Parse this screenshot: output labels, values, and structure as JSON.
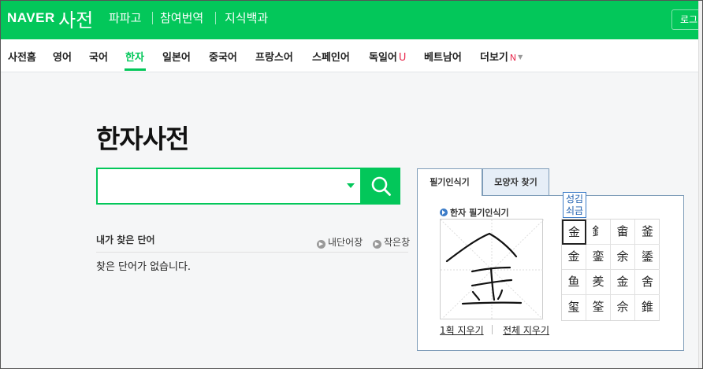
{
  "header": {
    "logo": "NAVER",
    "title": "사전",
    "nav": [
      "파파고",
      "참여번역",
      "지식백과"
    ],
    "login": "로그"
  },
  "langnav": {
    "items": [
      "사전홈",
      "영어",
      "국어",
      "한자",
      "일본어",
      "중국어",
      "프랑스어",
      "스페인어",
      "독일어",
      "베트남어",
      "더보기"
    ],
    "active": "한자",
    "badge_u": "U",
    "badge_n": "N"
  },
  "page_title": "한자사전",
  "search": {
    "value": "",
    "placeholder": ""
  },
  "history": {
    "title": "내가 찾은 단어",
    "link_my_words": "내단어장",
    "link_small_window": "작은창",
    "empty_text": "찾은 단어가 없습니다."
  },
  "recognizer": {
    "tab_handwriting": "필기인식기",
    "tab_shape": "모양자 찾기",
    "panel_title": "한자 필기인식기",
    "reading_line1": "성김",
    "reading_line2": "쇠금",
    "candidates": [
      "金",
      "釒",
      "畬",
      "釜",
      "金",
      "銮",
      "余",
      "鋈",
      "鱼",
      "羑",
      "金",
      "舍",
      "玺",
      "筌",
      "佘",
      "錐"
    ],
    "erase_one": "1획 지우기",
    "erase_all": "전체 지우기"
  },
  "colors": {
    "brand": "#03c75a",
    "accent_red": "#e8284d",
    "panel_border": "#7f9db9"
  },
  "icons": {
    "search": "search-icon",
    "dropdown": "chevron-down-icon"
  }
}
